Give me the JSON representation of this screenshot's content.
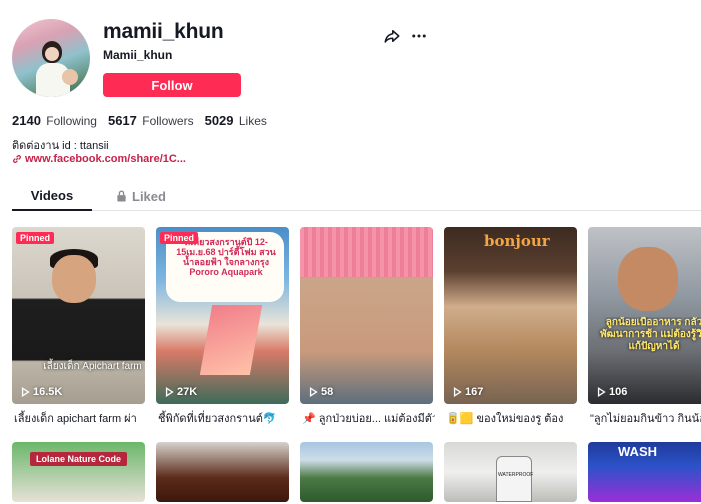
{
  "profile": {
    "username": "mamii_khun",
    "nickname": "Mamii_khun",
    "follow_label": "Follow",
    "stats": [
      {
        "value": "2140",
        "label": "Following"
      },
      {
        "value": "5617",
        "label": "Followers"
      },
      {
        "value": "5029",
        "label": "Likes"
      }
    ],
    "bio": "ติดต่องาน id : ttansii",
    "link": "www.facebook.com/share/1C..."
  },
  "tabs": {
    "videos": "Videos",
    "liked": "Liked"
  },
  "icons": {
    "share": "share-icon",
    "more": "more-icon",
    "link": "link-icon",
    "lock": "lock-icon",
    "play": "play-icon"
  },
  "colors": {
    "accent": "#fe2c55",
    "link": "#c4234a",
    "text": "#161823"
  },
  "videos": [
    {
      "pinned": "Pinned",
      "views": "16.5K",
      "overlay": "เลี้ยงเด็ก Apichart farm",
      "caption": "เลี้ยงเด็ก apichart farm ผ่า"
    },
    {
      "pinned": "Pinned",
      "views": "27K",
      "overlay": "ที่เที่ยวสงกรานต์ปี 12-15เม.ย.68 ปาร์ตี้โฟม สวนน้ำลอยฟ้า ใจกลางกรุง Pororo Aquapark",
      "caption": "ชี้พิกัดที่เที่ยวสงกรานต์🐬"
    },
    {
      "pinned": "",
      "views": "58",
      "overlay": "",
      "caption": "📌 ลูกป่วยบ่อย... แม่ต้องมีตัว"
    },
    {
      "pinned": "",
      "views": "167",
      "overlay": "bonjour",
      "caption": "🥫🟨 ของใหม่ของรู ต้อง"
    },
    {
      "pinned": "",
      "views": "106",
      "overlay": "ลูกน้อยเบื่ออาหาร กลัวพัฒนาการช้า แม่ต้องรู้วิธีแก้ปัญหาได้",
      "caption": "\"ลูกไม่ยอมกินข้าว กินน้อย"
    }
  ],
  "videos_row2": [
    {
      "overlay": "Lolane Nature Code"
    },
    {
      "overlay": ""
    },
    {
      "overlay": ""
    },
    {
      "overlay": "WATERPROOF"
    },
    {
      "overlay": "WASH"
    }
  ]
}
